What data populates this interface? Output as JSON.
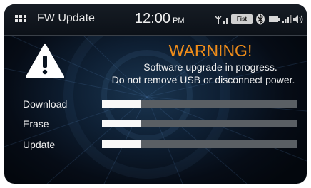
{
  "header": {
    "title": "FW Update",
    "time": "12:00",
    "ampm": "PM",
    "badge": "Fist"
  },
  "icons": {
    "menu": "grid-menu-icon",
    "antenna": "antenna-signal-icon",
    "bluetooth": "bluetooth-icon",
    "battery": "battery-icon",
    "signal": "cell-signal-icon",
    "volume": "volume-icon",
    "warning": "warning-triangle-icon"
  },
  "colors": {
    "warning": "#f08d1a",
    "progress_fill": "#f8f8f8",
    "progress_track": "#5a5f64"
  },
  "message": {
    "title": "WARNING!",
    "line1": "Software upgrade in progress.",
    "line2": "Do not remove USB or disconnect power."
  },
  "progress": [
    {
      "label": "Download",
      "fraction": 0.2
    },
    {
      "label": "Erase",
      "fraction": 0.2
    },
    {
      "label": "Update",
      "fraction": 0.2
    }
  ]
}
